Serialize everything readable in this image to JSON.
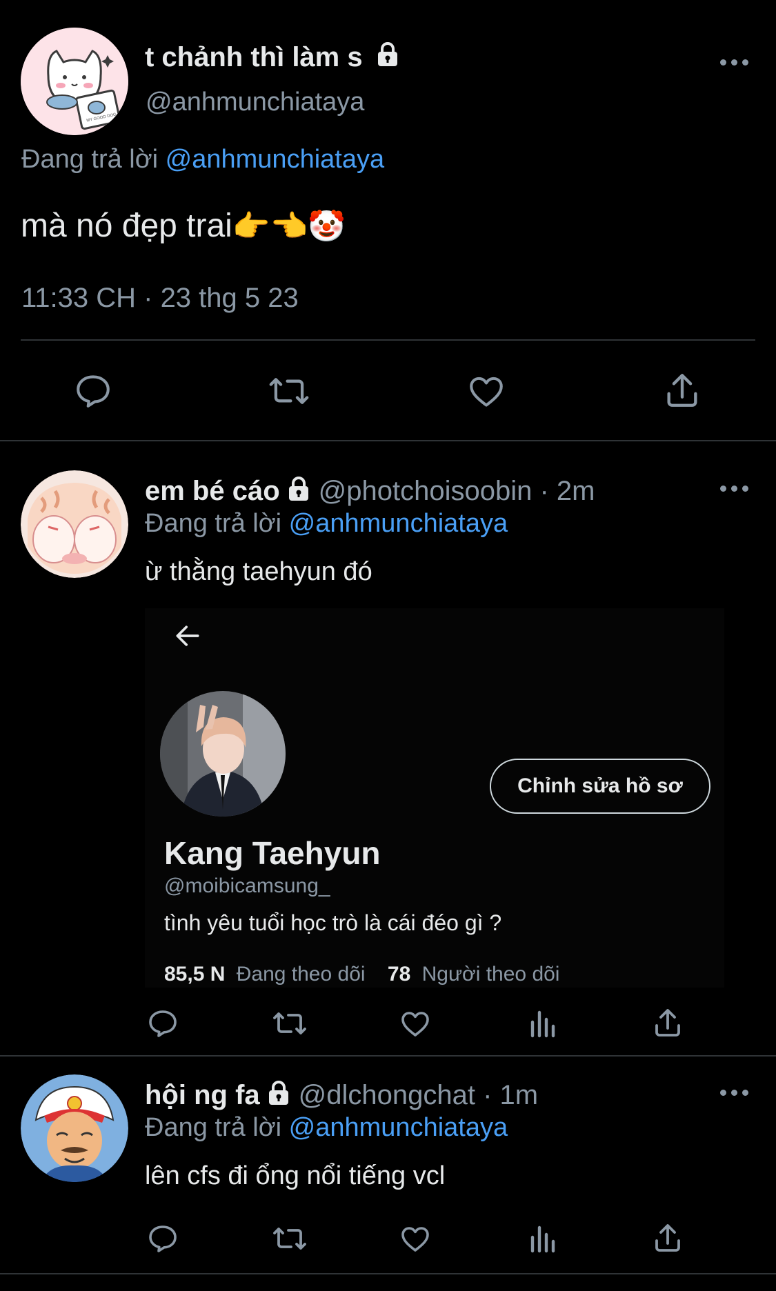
{
  "colors": {
    "background": "#000000",
    "text": "#e7e9ea",
    "muted": "#8b98a5",
    "link": "#4a9ff5",
    "divider": "#2f3336"
  },
  "main_tweet": {
    "name": "t chảnh thì làm s",
    "handle": "@anhmunchiataya",
    "reply_prefix": "Đang trả lời",
    "reply_to": "@anhmunchiataya",
    "text": "mà nó đẹp trai",
    "emoji": "👉👈🤡",
    "timestamp": "11:33 CH · 23 thg 5 23",
    "avatar_text": "MY GOOD DOG"
  },
  "reply1": {
    "name": "em bé cáo",
    "handle": "@photchoisoobin",
    "time": "· 2m",
    "reply_prefix": "Đang trả lời",
    "reply_to": "@anhmunchiataya",
    "text": "ừ thằng taehyun đó",
    "embed": {
      "edit_button": "Chỉnh sửa hồ sơ",
      "profile_name": "Kang Taehyun",
      "profile_handle": "@moibicamsung_",
      "bio": "tình yêu tuổi học trò là cái đéo gì ?",
      "following_count": "85,5 N",
      "following_label": "Đang theo dõi",
      "followers_count": "78",
      "followers_label": "Người theo dõi"
    }
  },
  "reply2": {
    "name": "hội ng fa",
    "handle": "@dlchongchat",
    "time": "· 1m",
    "reply_prefix": "Đang trả lời",
    "reply_to": "@anhmunchiataya",
    "text": "lên cfs đi ổng nổi tiếng vcl"
  },
  "icons": [
    "reply-icon",
    "retweet-icon",
    "like-icon",
    "share-icon",
    "analytics-icon",
    "lock-icon",
    "more-icon",
    "back-arrow-icon"
  ]
}
